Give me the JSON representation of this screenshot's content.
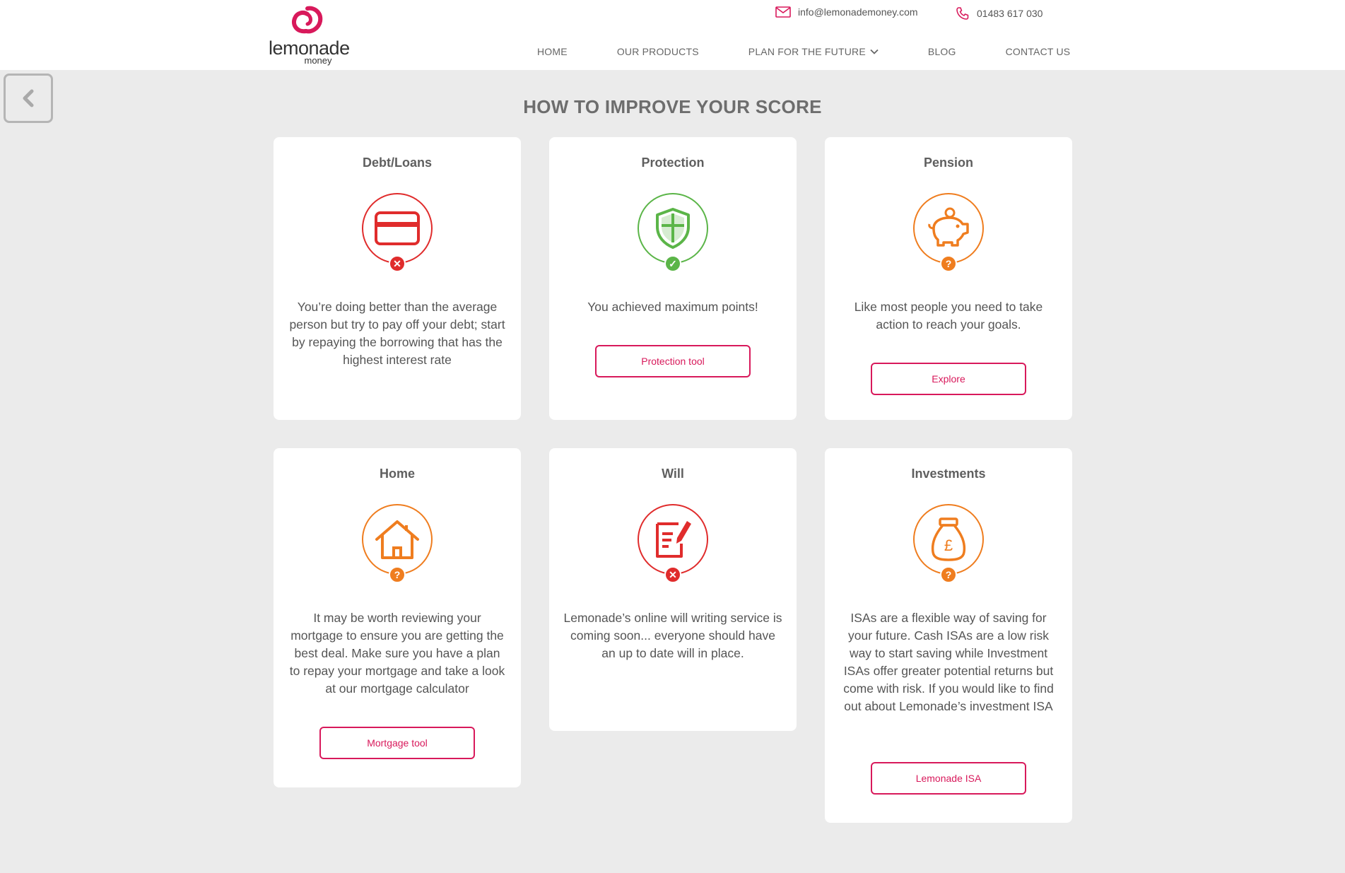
{
  "brand": {
    "name": "lemonade",
    "sub": "money",
    "color": "#d8195b"
  },
  "contact": {
    "email": "info@lemonademoney.com",
    "phone": "01483 617 030"
  },
  "nav": [
    {
      "label": "HOME"
    },
    {
      "label": "OUR PRODUCTS"
    },
    {
      "label": "PLAN FOR THE FUTURE"
    },
    {
      "label": "BLOG"
    },
    {
      "label": "CONTACT US"
    }
  ],
  "page_title": "HOW TO IMPROVE YOUR SCORE",
  "status_colors": {
    "bad": "#e02c2c",
    "good": "#5bb548",
    "maybe": "#ef7d1f"
  },
  "cards": [
    {
      "title": "Debt/Loans",
      "icon": "credit-card-icon",
      "status": "bad",
      "text": "You’re doing better than the average person but try to pay off your debt; start by repaying the borrowing that has the highest interest rate",
      "button": ""
    },
    {
      "title": "Protection",
      "icon": "shield-icon",
      "status": "good",
      "text": "You achieved maximum points!",
      "button": "Protection tool"
    },
    {
      "title": "Pension",
      "icon": "piggy-bank-icon",
      "status": "maybe",
      "text": "Like most people you need to take action to reach your goals.",
      "button": "Explore"
    },
    {
      "title": "Home",
      "icon": "house-icon",
      "status": "maybe",
      "text": "It may be worth reviewing your mortgage to ensure you are getting the best deal. Make sure you have a plan to repay your mortgage and take a look at our mortgage calculator",
      "button": "Mortgage tool"
    },
    {
      "title": "Will",
      "icon": "will-document-icon",
      "status": "bad",
      "text": "Lemonade’s online will writing service is coming soon... everyone should have an up to date will in place.",
      "button": ""
    },
    {
      "title": "Investments",
      "icon": "money-bag-icon",
      "status": "maybe",
      "text": "ISAs are a flexible way of saving for your future. Cash ISAs are a low risk way to start saving while Investment ISAs offer greater potential returns but come with risk. If you would like to find out about Lemonade’s investment ISA",
      "button": "Lemonade ISA"
    }
  ]
}
